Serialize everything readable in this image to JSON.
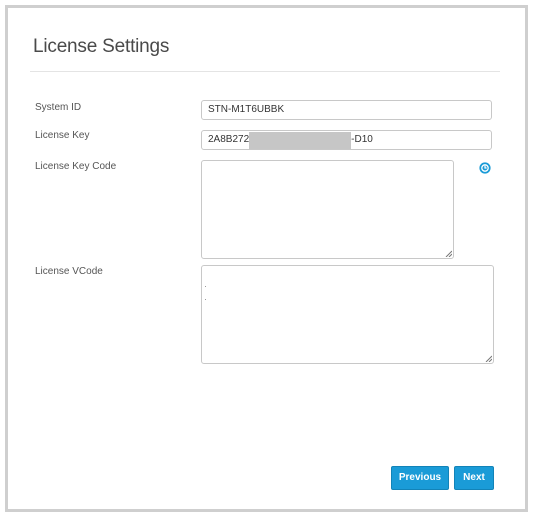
{
  "page": {
    "title": "License Settings"
  },
  "fields": {
    "system_id": {
      "label": "System ID",
      "value": "STN-M1T6UBBK"
    },
    "license_key": {
      "label": "License Key",
      "value_prefix": "2A8B272",
      "value_suffix": "-D10"
    },
    "license_key_code": {
      "label": "License Key Code",
      "value": ""
    },
    "license_vcode": {
      "label": "License VCode",
      "value": ""
    }
  },
  "buttons": {
    "previous": "Previous",
    "next": "Next"
  },
  "icons": {
    "help": "info-circle-icon"
  },
  "colors": {
    "accent": "#1a9bd7",
    "frame_border": "#cfcfcf",
    "redaction": "#c6c6c6"
  }
}
